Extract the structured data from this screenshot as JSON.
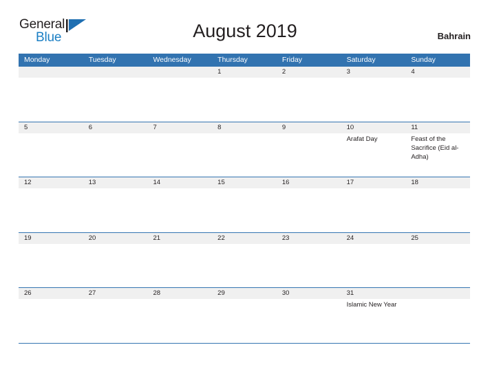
{
  "brand": {
    "word_one": "General",
    "word_two": "Blue",
    "flag_icon": "triangle-flag-icon",
    "color_dark": "#231f20",
    "color_blue": "#1b7fc4"
  },
  "header": {
    "title": "August 2019",
    "country": "Bahrain"
  },
  "theme": {
    "accent_blue": "#3273b0",
    "band_gray": "#f0f0f0",
    "text": "#231f20"
  },
  "calendar": {
    "weekdays": [
      "Monday",
      "Tuesday",
      "Wednesday",
      "Thursday",
      "Friday",
      "Saturday",
      "Sunday"
    ],
    "weeks": [
      [
        {
          "day": "",
          "event": ""
        },
        {
          "day": "",
          "event": ""
        },
        {
          "day": "",
          "event": ""
        },
        {
          "day": "1",
          "event": ""
        },
        {
          "day": "2",
          "event": ""
        },
        {
          "day": "3",
          "event": ""
        },
        {
          "day": "4",
          "event": ""
        }
      ],
      [
        {
          "day": "5",
          "event": ""
        },
        {
          "day": "6",
          "event": ""
        },
        {
          "day": "7",
          "event": ""
        },
        {
          "day": "8",
          "event": ""
        },
        {
          "day": "9",
          "event": ""
        },
        {
          "day": "10",
          "event": "Arafat Day"
        },
        {
          "day": "11",
          "event": "Feast of the Sacrifice (Eid al-Adha)"
        }
      ],
      [
        {
          "day": "12",
          "event": ""
        },
        {
          "day": "13",
          "event": ""
        },
        {
          "day": "14",
          "event": ""
        },
        {
          "day": "15",
          "event": ""
        },
        {
          "day": "16",
          "event": ""
        },
        {
          "day": "17",
          "event": ""
        },
        {
          "day": "18",
          "event": ""
        }
      ],
      [
        {
          "day": "19",
          "event": ""
        },
        {
          "day": "20",
          "event": ""
        },
        {
          "day": "21",
          "event": ""
        },
        {
          "day": "22",
          "event": ""
        },
        {
          "day": "23",
          "event": ""
        },
        {
          "day": "24",
          "event": ""
        },
        {
          "day": "25",
          "event": ""
        }
      ],
      [
        {
          "day": "26",
          "event": ""
        },
        {
          "day": "27",
          "event": ""
        },
        {
          "day": "28",
          "event": ""
        },
        {
          "day": "29",
          "event": ""
        },
        {
          "day": "30",
          "event": ""
        },
        {
          "day": "31",
          "event": "Islamic New Year"
        },
        {
          "day": "",
          "event": ""
        }
      ]
    ]
  }
}
